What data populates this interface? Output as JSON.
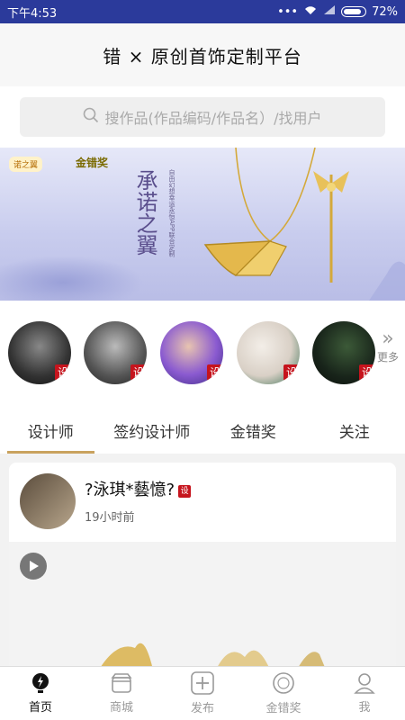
{
  "status": {
    "time": "下午4:53",
    "battery": "72%",
    "battery_level": 0.72
  },
  "header": {
    "title": "错 × 原创首饰定制平台"
  },
  "search": {
    "placeholder": "搜作品(作品编码/作品名）/找用户"
  },
  "banner": {
    "logo1": "诺之翼",
    "logo2": "金错奖",
    "calligraphy": "承诺之翼",
    "sub": "自由幻想幸运永恒APP联合定制"
  },
  "avatars": {
    "tag": "设",
    "more": "更多"
  },
  "tabs": [
    "设计师",
    "签约设计师",
    "金错奖",
    "关注"
  ],
  "card": {
    "name": "?泳琪*藝憶?",
    "tag": "设",
    "time": "19小时前"
  },
  "bottom_nav": [
    "首页",
    "商城",
    "发布",
    "金错奖",
    "我"
  ],
  "colors": {
    "status": "#2b3a9b",
    "accent": "#c9a25e",
    "tag": "#c6141d"
  }
}
